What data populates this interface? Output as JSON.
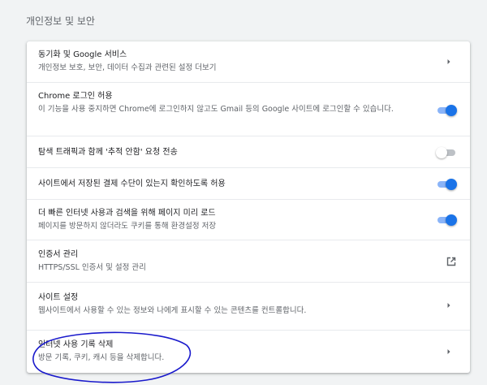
{
  "section": {
    "title": "개인정보 및 보안"
  },
  "rows": [
    {
      "label": "동기화 및 Google 서비스",
      "sub": "개인정보 보호, 보안, 데이터 수집과 관련된 설정 더보기",
      "control": "chevron"
    },
    {
      "label": "Chrome 로그인 허용",
      "sub": "이 기능을 사용 중지하면 Chrome에 로그인하지 않고도 Gmail 등의 Google 사이트에 로그인할 수 있습니다.",
      "control": "toggle",
      "checked": true
    },
    {
      "label": "탐색 트래픽과 함께 '추적 안함' 요청 전송",
      "control": "toggle",
      "checked": false
    },
    {
      "label": "사이트에서 저장된 결제 수단이 있는지 확인하도록 허용",
      "control": "toggle",
      "checked": true
    },
    {
      "label": "더 빠른 인터넷 사용과 검색을 위해 페이지 미리 로드",
      "sub": "페이지를 방문하지 않더라도 쿠키를 통해 환경설정 저장",
      "control": "toggle",
      "checked": true
    },
    {
      "label": "인증서 관리",
      "sub": "HTTPS/SSL 인증서 및 설정 관리",
      "control": "external-link"
    },
    {
      "label": "사이트 설정",
      "sub": "웹사이트에서 사용할 수 있는 정보와 나에게 표시할 수 있는 콘텐츠를 컨트롤합니다.",
      "control": "chevron"
    },
    {
      "label": "인터넷 사용 기록 삭제",
      "sub": "방문 기록, 쿠키, 캐시 등을 삭제합니다.",
      "control": "chevron"
    }
  ],
  "colors": {
    "accent": "#1a73e8",
    "accent_track": "#8ab4f8",
    "annotation_ink": "#1a1acc"
  },
  "icons": {
    "chevron": "chevron-right-icon",
    "external": "open-in-new-icon"
  }
}
